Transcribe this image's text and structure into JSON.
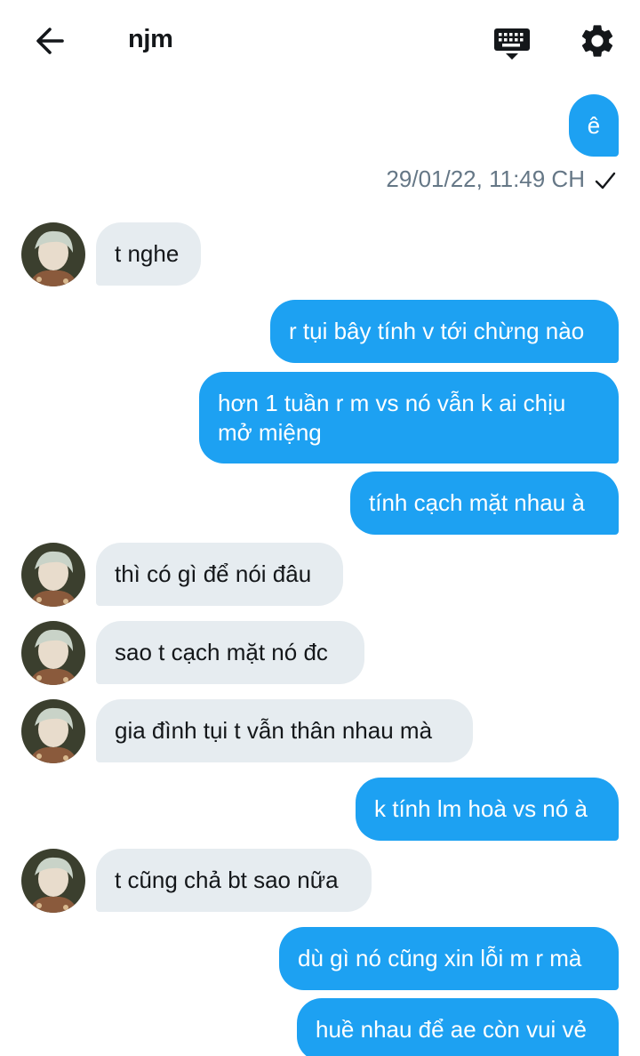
{
  "header": {
    "title": "njm",
    "back_icon": "arrow-left-icon",
    "keyboard_icon": "keyboard-icon",
    "settings_icon": "gear-icon"
  },
  "colors": {
    "sent_bubble": "#1da1f2",
    "received_bubble": "#e6ecf0",
    "timestamp": "#657786"
  },
  "messages": [
    {
      "from": "me",
      "text": "ê"
    },
    {
      "from": "me_meta",
      "timestamp": "29/01/22, 11:49 CH",
      "status": "check-icon"
    },
    {
      "from": "them",
      "text": "t nghe"
    },
    {
      "from": "me",
      "text": "r tụi bây tính v tới chừng nào"
    },
    {
      "from": "me",
      "text": "hơn 1 tuần r m vs nó vẫn k ai chịu mở miệng"
    },
    {
      "from": "me",
      "text": "tính cạch mặt nhau à"
    },
    {
      "from": "them",
      "text": "thì có gì để nói đâu"
    },
    {
      "from": "them",
      "text": "sao t cạch mặt nó đc"
    },
    {
      "from": "them",
      "text": "gia đình tụi t vẫn thân nhau mà"
    },
    {
      "from": "me",
      "text": "k tính lm hoà vs nó à"
    },
    {
      "from": "them",
      "text": "t cũng chả bt sao nữa"
    },
    {
      "from": "me",
      "text": "dù gì nó cũng xin lỗi m r mà"
    },
    {
      "from": "me",
      "text": "huề nhau để ae còn vui vẻ"
    }
  ]
}
